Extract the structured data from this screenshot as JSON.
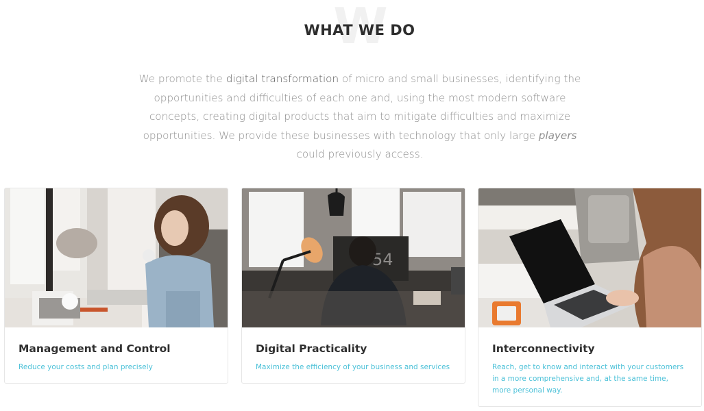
{
  "section": {
    "watermark_letter": "W",
    "title": "WHAT WE DO",
    "intro": {
      "part1": "We promote the ",
      "highlight": "digital transformation",
      "part2": " of micro and small businesses, identifying the opportunities and difficulties of each one and, using the most modern software concepts, creating digital products that aim to mitigate difficulties and maximize opportunities. We provide these businesses with technology that only large ",
      "italic": "players",
      "part3": " could previously access."
    }
  },
  "cards": [
    {
      "title": "Management and Control",
      "text": "Reduce your costs and plan precisely",
      "image": "woman-at-laptop-window-photo"
    },
    {
      "title": "Digital Practicality",
      "text": "Maximize the efficiency of your business and services",
      "image": "man-at-desk-lamp-photo",
      "monitor_label": "54"
    },
    {
      "title": "Interconnectivity",
      "text": "Reach, get to know and interact with your customers in a more comprehensive and, at the same time, more personal way.",
      "image": "woman-with-macbook-photo"
    }
  ],
  "colors": {
    "accent": "#4cc1d8",
    "title": "#2d2d2d",
    "body_text": "#8f8f8f",
    "border": "#e6e6e6"
  }
}
